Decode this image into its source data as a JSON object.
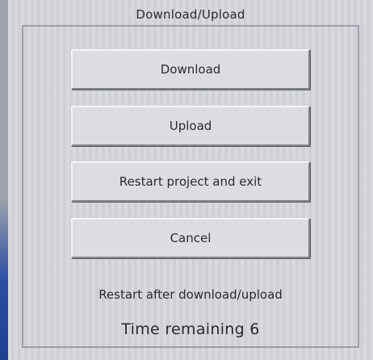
{
  "dialog": {
    "title": "Download/Upload",
    "buttons": {
      "download": "Download",
      "upload": "Upload",
      "restart_exit": "Restart project and exit",
      "cancel": "Cancel"
    },
    "restart_note": "Restart after download/upload",
    "time_remaining": "Time remaining 6"
  }
}
